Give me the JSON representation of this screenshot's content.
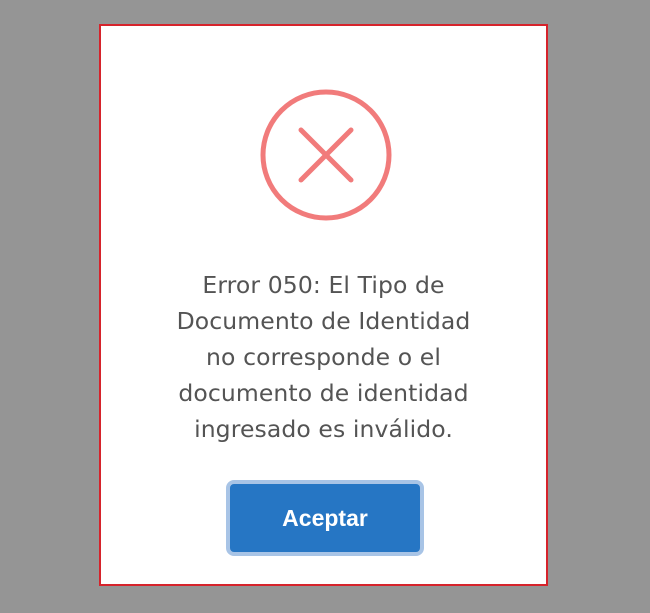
{
  "dialog": {
    "icon": "error-circle-x-icon",
    "message_lines": [
      "Error 050: El Tipo de",
      "Documento de Identidad",
      "no corresponde o el",
      "documento de identidad",
      "ingresado es inválido."
    ],
    "button_label": "Aceptar"
  },
  "colors": {
    "overlay": "#959595",
    "dialog_border": "#d6232b",
    "error_icon": "#f17b7b",
    "message_text": "#545454",
    "button_background": "#2676c4",
    "button_outline": "#a8c4e6",
    "button_text": "#ffffff"
  }
}
